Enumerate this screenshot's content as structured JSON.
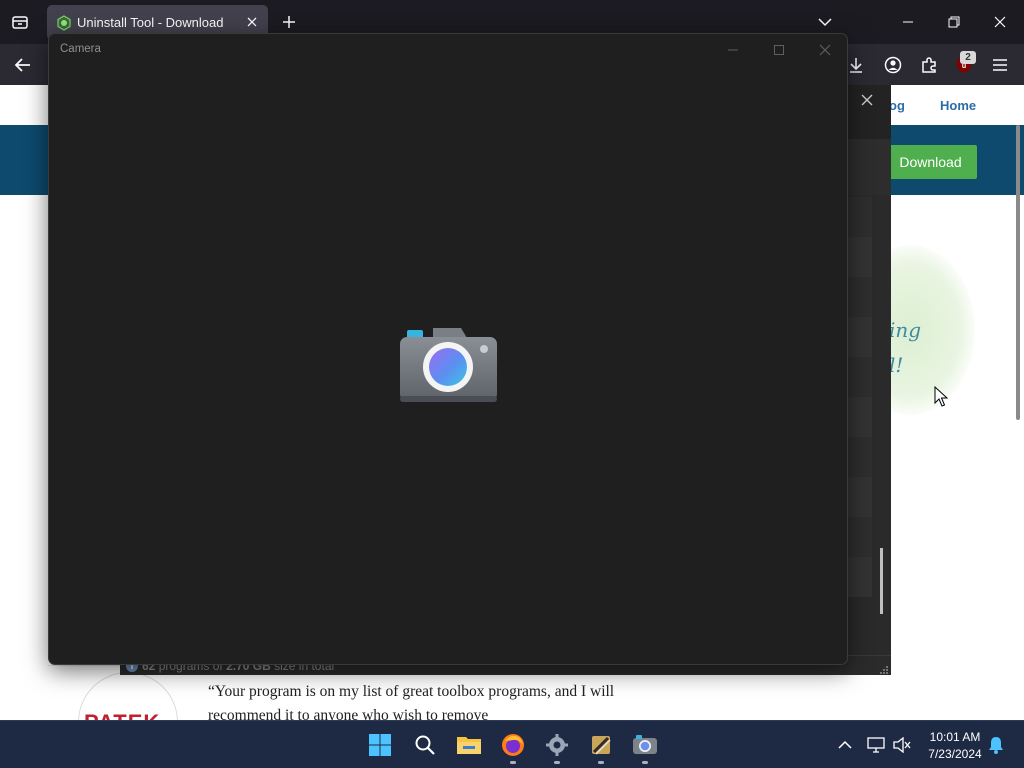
{
  "browser": {
    "tab": {
      "title": "Uninstall Tool - Download"
    },
    "toolbar": {
      "badge_count": "2"
    }
  },
  "webpage": {
    "nav": {
      "links": [
        "og",
        "Home"
      ]
    },
    "hero": {
      "download_label": "Download"
    },
    "handwriting": [
      "ing",
      "l!"
    ],
    "testimonial": {
      "logo_text": "PATEK",
      "quote": "“Your program is on my list of great toolbox programs, and I will recommend it to anyone who wish to remove"
    }
  },
  "uninstall_tool": {
    "status": {
      "count": "62",
      "programs_of": "programs of",
      "size": "2.70 GB",
      "suffix": "size in total"
    }
  },
  "camera": {
    "title": "Camera"
  },
  "taskbar": {
    "apps": [
      "start",
      "search",
      "file-explorer",
      "firefox",
      "settings",
      "uninstall-tool",
      "camera"
    ],
    "clock": {
      "time": "10:01 AM",
      "date": "7/23/2024"
    }
  },
  "colors": {
    "hero": "#0d4a6e",
    "download_button": "#4fae4d",
    "camera_bg": "#1f1f1f",
    "taskbar": "#1e2a44"
  }
}
